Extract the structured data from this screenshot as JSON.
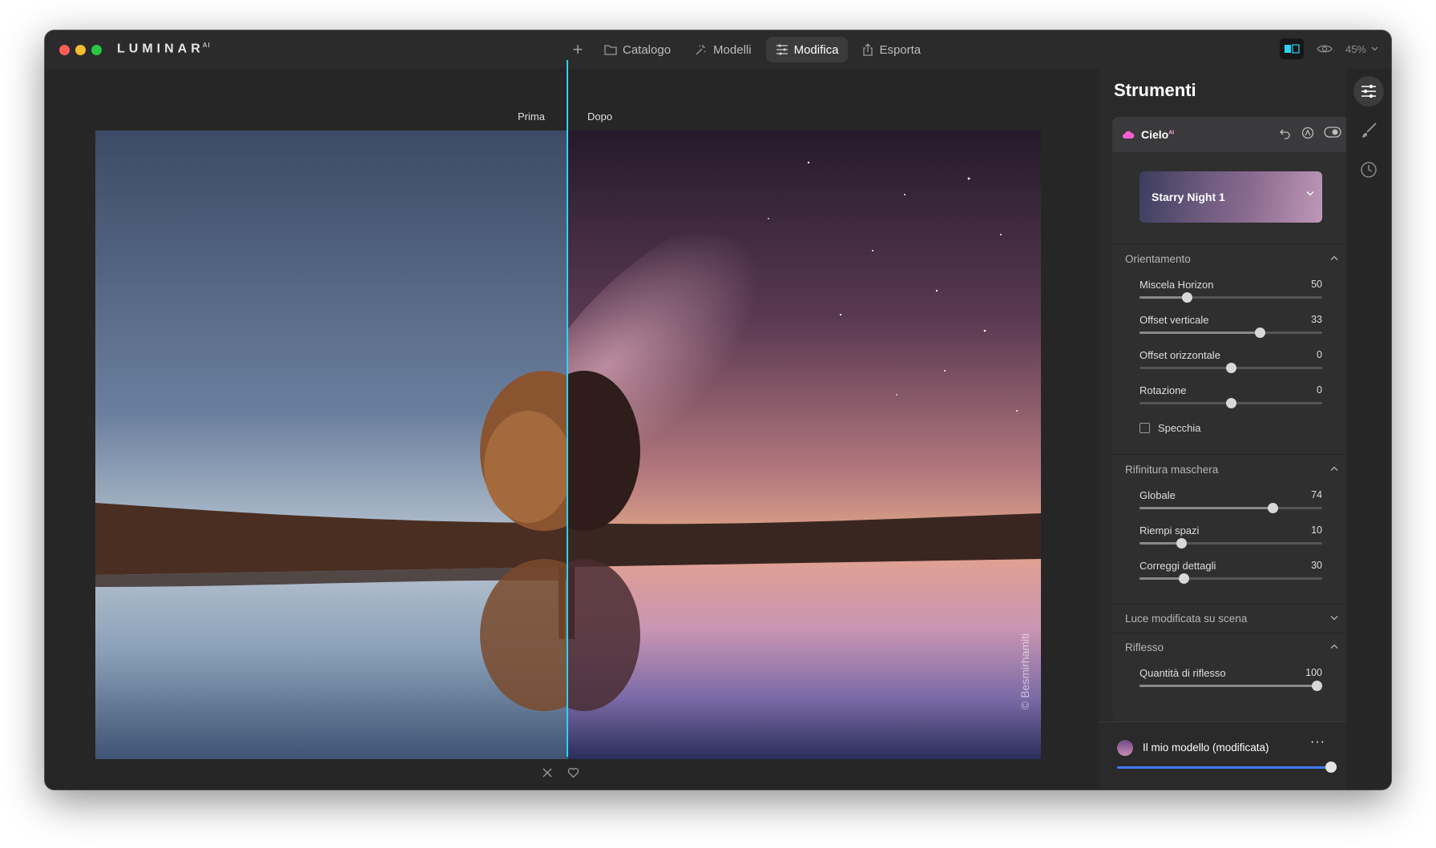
{
  "app": {
    "logo": "LUMINAR",
    "logo_sup": "AI"
  },
  "nav": {
    "add_label": "+",
    "items": [
      {
        "label": "Catalogo",
        "icon": "folder-icon"
      },
      {
        "label": "Modelli",
        "icon": "sparkle-icon"
      },
      {
        "label": "Modifica",
        "icon": "sliders-icon",
        "active": true
      },
      {
        "label": "Esporta",
        "icon": "share-icon"
      }
    ]
  },
  "view": {
    "zoom": "45%"
  },
  "compare": {
    "before": "Prima",
    "after": "Dopo"
  },
  "photo": {
    "watermark": "© Besmirhamiti"
  },
  "panel": {
    "title": "Strumenti",
    "tool": {
      "name": "Cielo",
      "badge": "AI",
      "sky_selection": "Starry Night 1"
    },
    "sections": {
      "orientamento": {
        "title": "Orientamento",
        "sliders": [
          {
            "name": "Miscela Horizon",
            "value": "50",
            "fraction": 0.26
          },
          {
            "name": "Offset verticale",
            "value": "33",
            "fraction": 0.66
          },
          {
            "name": "Offset orizzontale",
            "value": "0",
            "fraction": 0.5
          },
          {
            "name": "Rotazione",
            "value": "0",
            "fraction": 0.5
          }
        ],
        "checkbox": "Specchia"
      },
      "rifinitura": {
        "title": "Rifinitura maschera",
        "sliders": [
          {
            "name": "Globale",
            "value": "74",
            "fraction": 0.73
          },
          {
            "name": "Riempi spazi",
            "value": "10",
            "fraction": 0.23
          },
          {
            "name": "Correggi dettagli",
            "value": "30",
            "fraction": 0.24
          }
        ]
      },
      "luce": {
        "title": "Luce modificata su scena"
      },
      "riflesso": {
        "title": "Riflesso",
        "sliders": [
          {
            "name": "Quantità di riflesso",
            "value": "100",
            "fraction": 0.97
          }
        ]
      }
    },
    "template": {
      "name": "Il mio modello (modificata)",
      "more": "···"
    }
  }
}
